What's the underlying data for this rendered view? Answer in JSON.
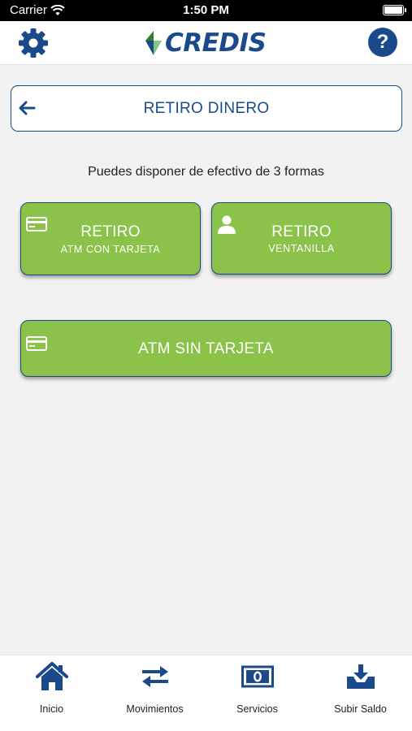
{
  "status_bar": {
    "carrier": "Carrier",
    "time": "1:50 PM"
  },
  "header": {
    "brand": "CREDIS",
    "help_label": "?"
  },
  "screen": {
    "title": "RETIRO DINERO",
    "subtitle": "Puedes disponer de efectivo de 3 formas"
  },
  "options": {
    "atm_con": {
      "main": "RETIRO",
      "sub": "ATM CON TARJETA"
    },
    "ventanilla": {
      "main": "RETIRO",
      "sub": "VENTANILLA"
    },
    "atm_sin": {
      "main": "ATM SIN TARJETA"
    }
  },
  "tabs": [
    {
      "label": "Inicio",
      "icon": "home-icon"
    },
    {
      "label": "Movimientos",
      "icon": "swap-arrows-icon"
    },
    {
      "label": "Servicios",
      "icon": "banknote-icon"
    },
    {
      "label": "Subir Saldo",
      "icon": "download-tray-icon"
    }
  ],
  "colors": {
    "brand_blue": "#1a4a8c",
    "option_green": "#8bc34a",
    "background": "#f2f2f2"
  }
}
